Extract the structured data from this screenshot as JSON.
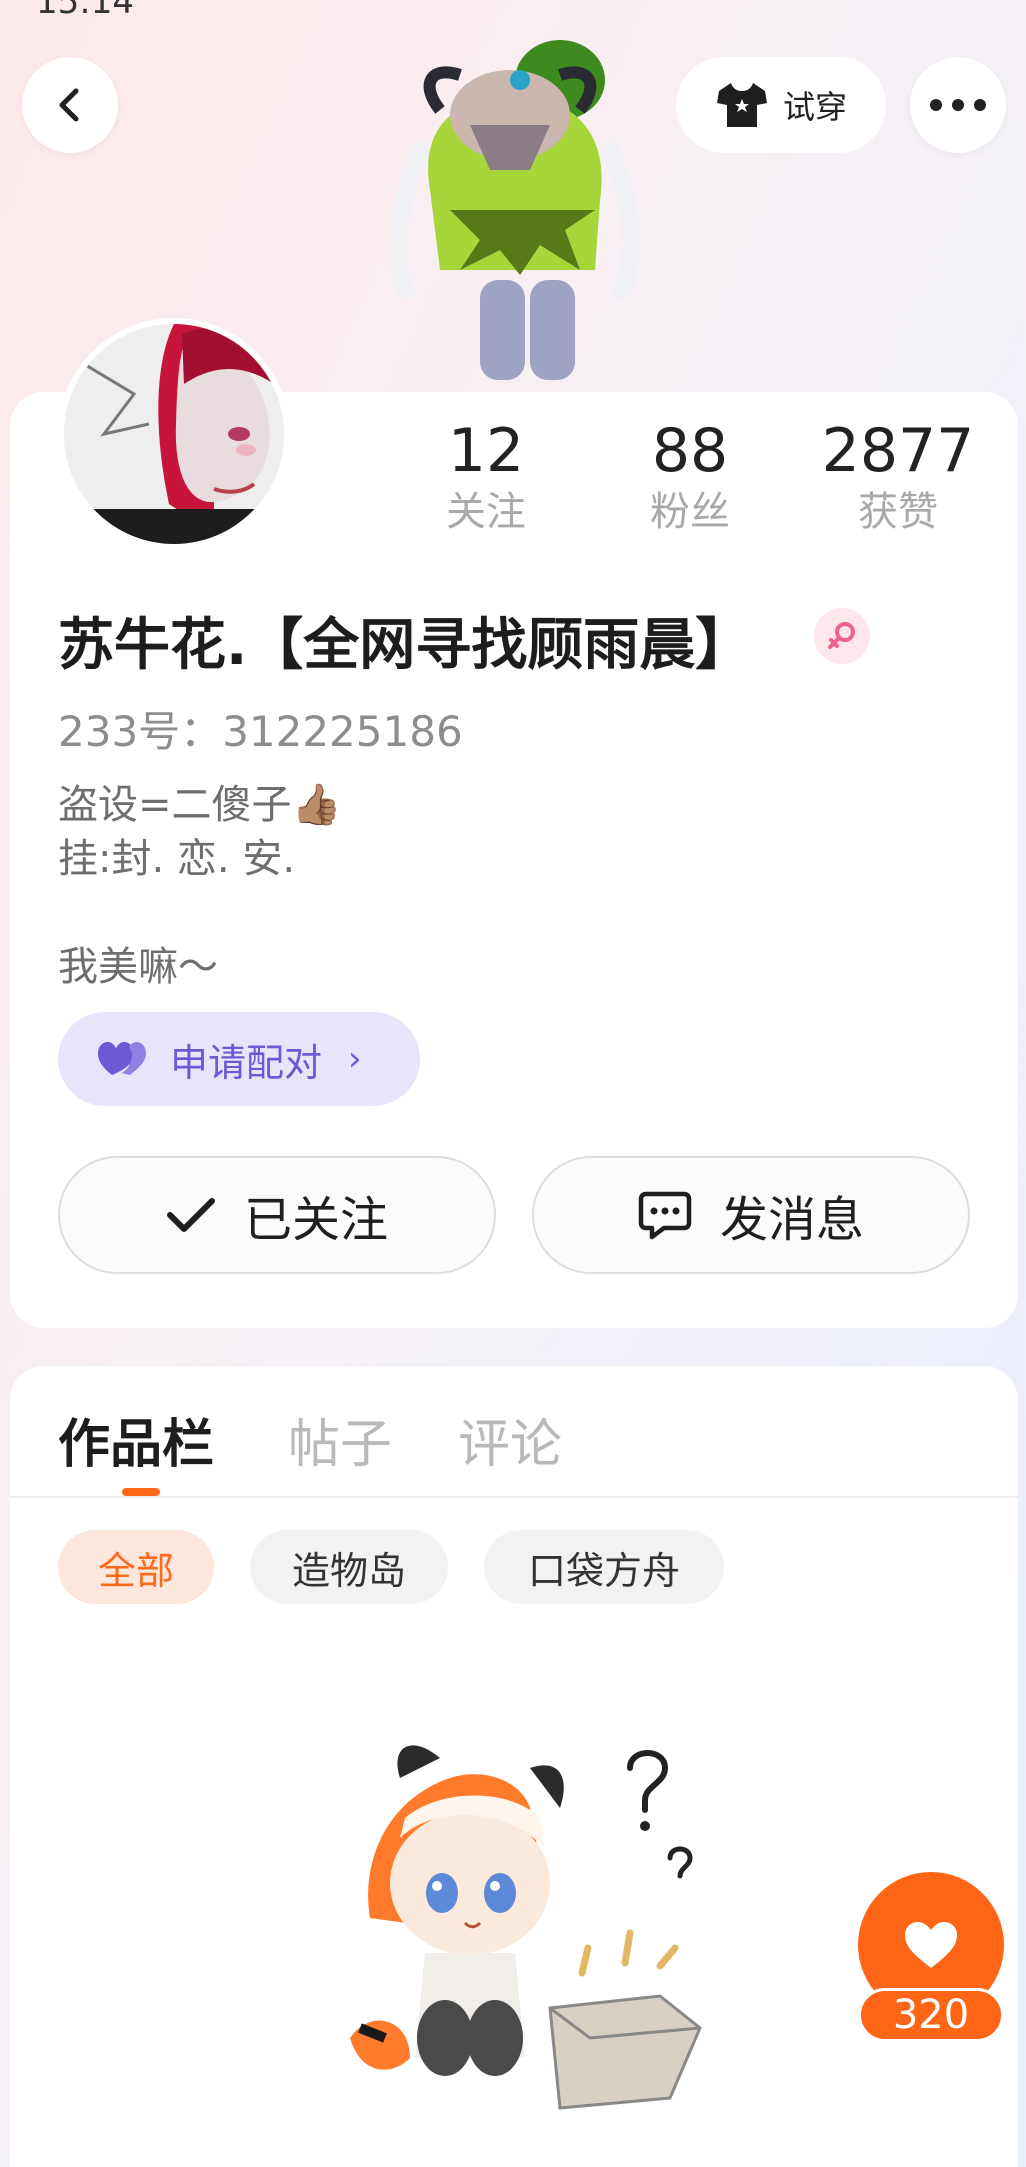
{
  "status_bar": {
    "time": "15:14"
  },
  "header": {
    "try_on_label": "试穿",
    "icons": {
      "back": "chevron-left-icon",
      "tryon": "shirt-icon",
      "more": "more-dots-icon"
    }
  },
  "profile": {
    "stats": [
      {
        "value": "12",
        "label": "关注"
      },
      {
        "value": "88",
        "label": "粉丝"
      },
      {
        "value": "2877",
        "label": "获赞"
      }
    ],
    "nickname": "苏牛花.【全网寻找顾雨晨】",
    "gender": "female",
    "uid": "233号：312225186",
    "bio_line1": "盗设=二傻子👍🏽",
    "bio_line2": "挂:封. 恋. 安.",
    "bio_line3": "我美嘛～",
    "pair_button": "申请配对",
    "follow_button": "已关注",
    "message_button": "发消息",
    "colors": {
      "pair_accent": "#6c5ad4",
      "pair_bg": "#e8e4fc"
    }
  },
  "content": {
    "tabs": [
      {
        "label": "作品栏",
        "active": true
      },
      {
        "label": "帖子",
        "active": false
      },
      {
        "label": "评论",
        "active": false
      }
    ],
    "chips": [
      {
        "label": "全部",
        "active": true
      },
      {
        "label": "造物岛",
        "active": false
      },
      {
        "label": "口袋方舟",
        "active": false
      }
    ],
    "accent": "#ff6a1a"
  },
  "like_fab": {
    "count": "320",
    "icon": "heart-icon"
  }
}
